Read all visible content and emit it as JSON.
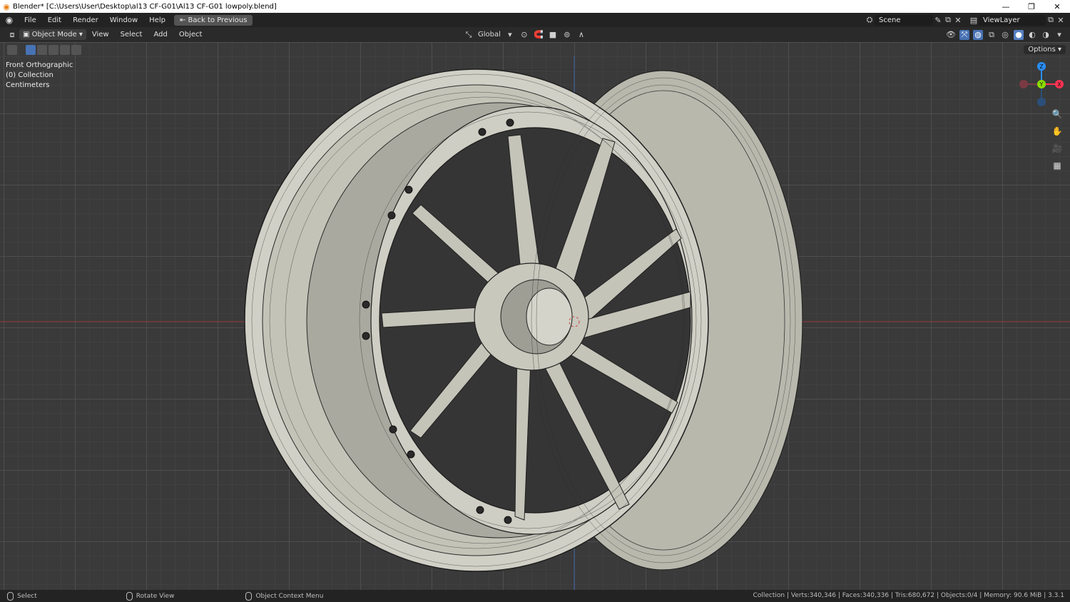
{
  "window": {
    "title": "Blender* [C:\\Users\\User\\Desktop\\al13 CF-G01\\Al13 CF-G01 lowpoly.blend]",
    "minimize": "—",
    "restore": "❐",
    "close": "✕"
  },
  "menubar": {
    "items": [
      "File",
      "Edit",
      "Render",
      "Window",
      "Help"
    ],
    "back_button": "Back to Previous",
    "scene": "Scene",
    "view_layer": "ViewLayer"
  },
  "viewport_header": {
    "mode": "Object Mode",
    "menus": [
      "View",
      "Select",
      "Add",
      "Object"
    ],
    "orientation": "Global"
  },
  "viewport": {
    "view_name": "Front Orthographic",
    "collection": "(0) Collection",
    "units": "Centimeters",
    "options_label": "Options",
    "gizmo_labels": {
      "z": "Z",
      "y": "Y",
      "x": "X"
    }
  },
  "statusbar": {
    "select": "Select",
    "rotate": "Rotate View",
    "context": "Object Context Menu",
    "stats": "Collection | Verts:340,346 | Faces:340,336 | Tris:680,672 | Objects:0/4 | Memory: 90.6 MiB | 3.3.1"
  },
  "colors": {
    "accent": "#4772b3",
    "x_axis": "#ff3352",
    "y_axis": "#8bdc00",
    "z_axis": "#2890ff",
    "rim": "#c9c8bd"
  }
}
